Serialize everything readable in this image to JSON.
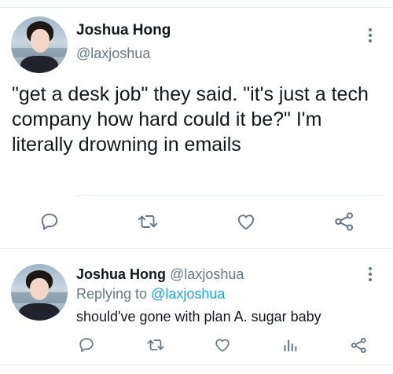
{
  "tweet": {
    "author_name": "Joshua Hong",
    "author_handle": "@laxjoshua",
    "text": "\"get a desk job\" they said. \"it's just a tech company how hard could it be?\" I'm literally drowning in emails",
    "actions": [
      "reply-icon",
      "retweet-icon",
      "like-icon",
      "share-icon"
    ]
  },
  "reply": {
    "author_name": "Joshua Hong",
    "author_handle": "@laxjoshua",
    "replying_prefix": "Replying to",
    "replying_handle": "@laxjoshua",
    "text": "should've gone with plan A. sugar baby",
    "actions": [
      "reply-icon",
      "retweet-icon",
      "like-icon",
      "analytics-icon",
      "share-icon"
    ]
  },
  "colors": {
    "text": "#14171a",
    "secondary": "#657786",
    "link": "#1da1f2",
    "divider": "#e6ecf0"
  }
}
